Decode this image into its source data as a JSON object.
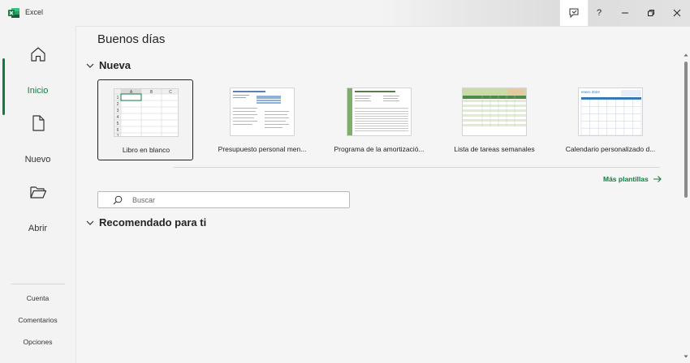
{
  "window": {
    "app_name": "Excel",
    "buttons": {
      "help": "?",
      "minimize": "—",
      "restore": "❐",
      "close": "✕"
    }
  },
  "sidebar": {
    "items": [
      {
        "label": "Inicio",
        "icon": "home-icon",
        "active": true
      },
      {
        "label": "Nuevo",
        "icon": "new-document-icon",
        "active": false
      },
      {
        "label": "Abrir",
        "icon": "open-folder-icon",
        "active": false
      }
    ],
    "bottom": [
      "Cuenta",
      "Comentarios",
      "Opciones"
    ]
  },
  "main": {
    "greeting": "Buenos días",
    "new_section": "Nueva",
    "templates": [
      {
        "name": "Libro en blanco",
        "selected": true
      },
      {
        "name": "Presupuesto personal men...",
        "selected": false
      },
      {
        "name": "Programa de la amortizació...",
        "selected": false
      },
      {
        "name": "Lista de tareas semanales",
        "selected": false
      },
      {
        "name": "Calendario personalizado d...",
        "selected": false
      }
    ],
    "more_templates": "Más plantillas",
    "search_placeholder": "Buscar",
    "recommended_section": "Recomendado para ti",
    "blank_sheet": {
      "columns": [
        "A",
        "B",
        "C"
      ],
      "rows": [
        "1",
        "2",
        "3",
        "4",
        "5",
        "6",
        "7"
      ]
    },
    "thumb_text": {
      "calendar_title": "enero 2024"
    }
  },
  "colors": {
    "accent": "#107c41",
    "background": "#f3f3f3"
  }
}
